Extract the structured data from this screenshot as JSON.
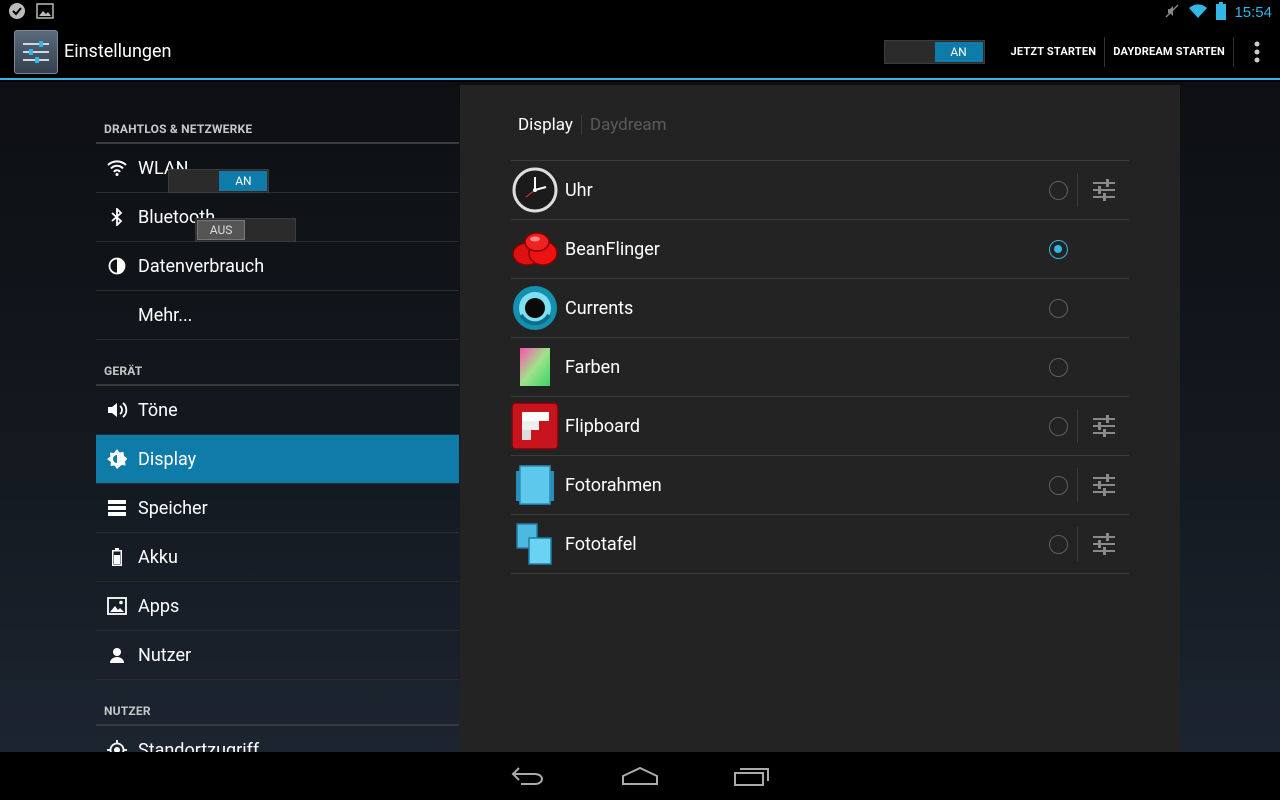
{
  "status_bar": {
    "time": "15:54"
  },
  "action_bar": {
    "title": "Einstellungen",
    "master_toggle_label": "AN",
    "start_now_label": "JETZT STARTEN",
    "start_daydream_label": "DAYDREAM STARTEN"
  },
  "sidebar": {
    "sections": [
      {
        "header": "DRAHTLOS & NETZWERKE",
        "items": [
          {
            "label": "WLAN",
            "icon": "wifi-icon",
            "toggle": "AN"
          },
          {
            "label": "Bluetooth",
            "icon": "bluetooth-icon",
            "toggle": "AUS"
          },
          {
            "label": "Datenverbrauch",
            "icon": "data-usage-icon"
          },
          {
            "label": "Mehr..."
          }
        ]
      },
      {
        "header": "GERÄT",
        "items": [
          {
            "label": "Töne",
            "icon": "sound-icon"
          },
          {
            "label": "Display",
            "icon": "brightness-icon",
            "selected": true
          },
          {
            "label": "Speicher",
            "icon": "storage-icon"
          },
          {
            "label": "Akku",
            "icon": "battery-icon"
          },
          {
            "label": "Apps",
            "icon": "apps-icon"
          },
          {
            "label": "Nutzer",
            "icon": "user-icon"
          }
        ]
      },
      {
        "header": "NUTZER",
        "items": [
          {
            "label": "Standortzugriff",
            "icon": "location-icon"
          }
        ]
      }
    ]
  },
  "content": {
    "tabs": [
      "Display",
      "Daydream"
    ],
    "active_tab": "Daydream",
    "dreams": [
      {
        "label": "Uhr",
        "icon": "clock-icon",
        "selected": false,
        "has_settings": true
      },
      {
        "label": "BeanFlinger",
        "icon": "jellybean-icon",
        "selected": true,
        "has_settings": false
      },
      {
        "label": "Currents",
        "icon": "currents-icon",
        "selected": false,
        "has_settings": false
      },
      {
        "label": "Farben",
        "icon": "colors-icon",
        "selected": false,
        "has_settings": false
      },
      {
        "label": "Flipboard",
        "icon": "flipboard-icon",
        "selected": false,
        "has_settings": true
      },
      {
        "label": "Fotorahmen",
        "icon": "photo-frame-icon",
        "selected": false,
        "has_settings": true
      },
      {
        "label": "Fototafel",
        "icon": "photo-table-icon",
        "selected": false,
        "has_settings": true
      }
    ]
  },
  "colors": {
    "accent": "#33b5e5",
    "selected_item": "#0e7ba8"
  }
}
